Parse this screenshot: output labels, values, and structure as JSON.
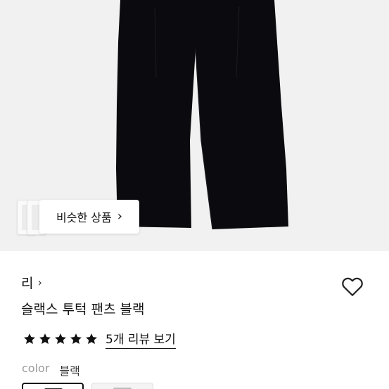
{
  "product_image": {
    "similar_button_label": "비슷한 상품",
    "similar_button_icon": "chevron-right-icon"
  },
  "product_info": {
    "brand": "리",
    "brand_icon": "chevron-right-icon",
    "title": "슬랙스 투턱 팬츠 블랙",
    "rating_stars": 5,
    "review_link": "5개 리뷰 보기",
    "color_label": "color",
    "color_value": "블랙",
    "wishlist_icon": "heart-outline-icon"
  },
  "colors": {
    "background_image": "#f1f1f1",
    "pants": "#0b0b0f",
    "text": "#111111",
    "muted": "#9a9a9a"
  }
}
